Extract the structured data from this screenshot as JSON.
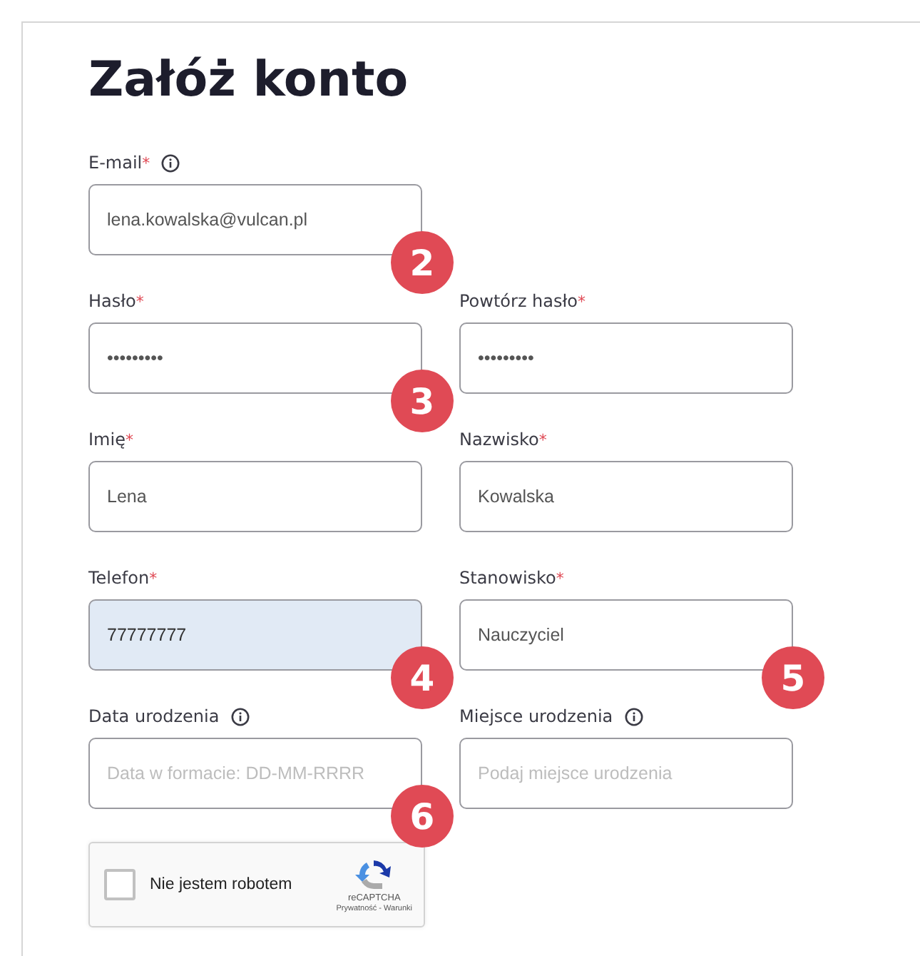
{
  "heading": "Załóż konto",
  "required_marker": "*",
  "rows": [
    [
      {
        "label": "E-mail",
        "required": true,
        "info": true,
        "value": "lena.kowalska@vulcan.pl",
        "highlighted": false,
        "callout": "2"
      }
    ],
    [
      {
        "label": "Hasło",
        "required": true,
        "info": false,
        "value": "•••••••••",
        "highlighted": false,
        "callout": "3"
      },
      {
        "label": "Powtórz hasło",
        "required": true,
        "info": false,
        "value": "•••••••••",
        "highlighted": false
      }
    ],
    [
      {
        "label": "Imię",
        "required": true,
        "info": false,
        "value": "Lena",
        "highlighted": false
      },
      {
        "label": "Nazwisko",
        "required": true,
        "info": false,
        "value": "Kowalska",
        "highlighted": false
      }
    ],
    [
      {
        "label": "Telefon",
        "required": true,
        "info": false,
        "value": "77777777",
        "highlighted": true,
        "callout": "4"
      },
      {
        "label": "Stanowisko",
        "required": true,
        "info": false,
        "value": "Nauczyciel",
        "highlighted": false,
        "callout": "5"
      }
    ],
    [
      {
        "label": "Data urodzenia",
        "required": false,
        "info": true,
        "placeholder": "Data w formacie: DD-MM-RRRR",
        "highlighted": false,
        "callout": "6"
      },
      {
        "label": "Miejsce urodzenia",
        "required": false,
        "info": true,
        "placeholder": "Podaj miejsce urodzenia",
        "highlighted": false
      }
    ]
  ],
  "captcha": {
    "label": "Nie jestem robotem",
    "checked": false,
    "brand": "reCAPTCHA",
    "links": "Prywatność - Warunki"
  }
}
